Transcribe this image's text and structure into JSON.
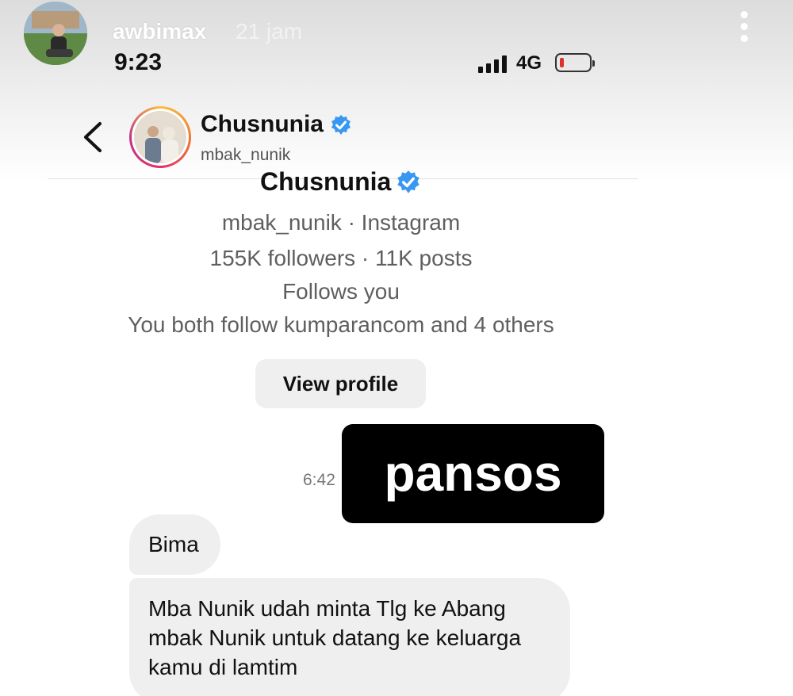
{
  "story": {
    "username": "awbimax",
    "posted_ago": "21 jam",
    "more_icon": "more-vertical-icon"
  },
  "status_bar": {
    "time": "9:23",
    "network": "4G",
    "battery_color": "#e0302c"
  },
  "chat_header": {
    "name": "Chusnunia",
    "handle": "mbak_nunik",
    "verified_color": "#3897f0",
    "back_icon": "chevron-left-icon"
  },
  "profile_card": {
    "name": "Chusnunia",
    "subtitle": "mbak_nunik · Instagram",
    "stats": "155K followers · 11K posts",
    "follows_you": "Follows you",
    "mutual": "You both follow kumparancom and 4 others",
    "button_label": "View profile"
  },
  "messages": {
    "sent_time": "6:42",
    "sticker_text": "pansos",
    "received": [
      "Bima",
      "Mba Nunik udah minta Tlg ke Abang mbak Nunik untuk datang ke keluarga kamu di lamtim"
    ]
  }
}
